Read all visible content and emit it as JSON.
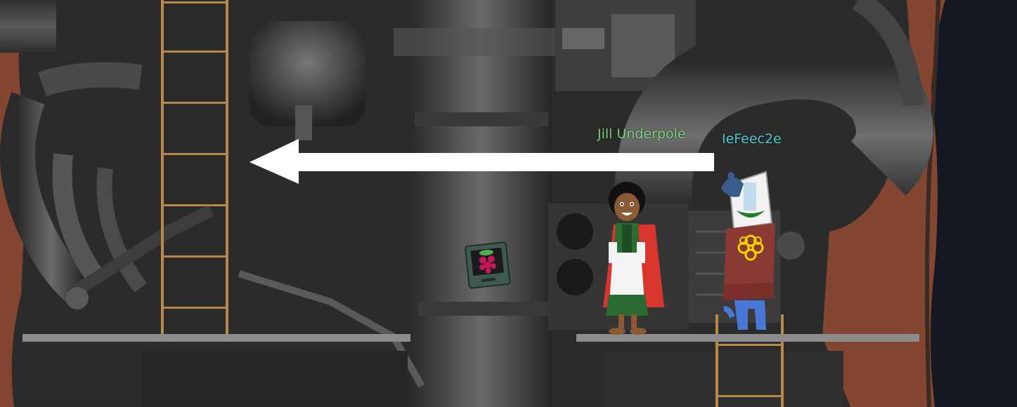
{
  "scene": {
    "colors": {
      "rust_wall": "#8a4a35",
      "machinery_dark": "#2b2b2b",
      "machinery_mid": "#5a5a5a",
      "platform": "#8c8c8c",
      "ladder": "#b8874a",
      "arrow": "#ffffff",
      "night_strip": "#141822"
    }
  },
  "players": [
    {
      "name": "Jill Underpole",
      "color": "#7ed07a"
    },
    {
      "name": "IeFeec2e",
      "color": "#4ec8d2"
    }
  ],
  "items": [
    {
      "name": "raspberry-pi-terminal",
      "icon": "raspberry-icon"
    }
  ]
}
